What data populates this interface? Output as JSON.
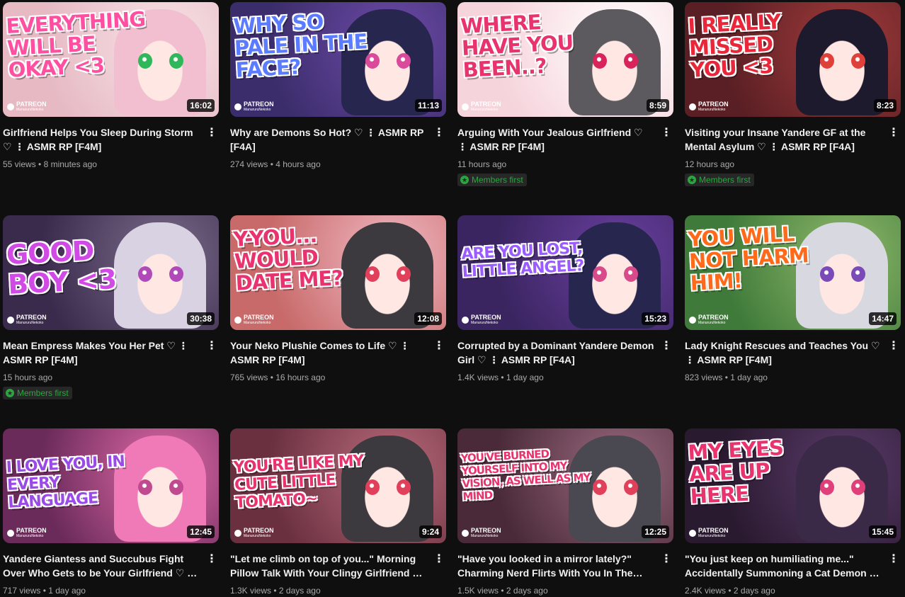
{
  "videos": [
    {
      "title": "Girlfriend Helps You Sleep During Storm ♡ ⋮ ASMR RP [F4M]",
      "views": "55 views",
      "age": "8 minutes ago",
      "duration": "16:02",
      "members_first": "",
      "thumb_text": "Everything will be okay <3",
      "text_color": "#ff4fa0",
      "bg": "#e6b9c3",
      "bg2": "#f7e2e6",
      "hair": "#f2bfd0",
      "eye": "#2fb85a"
    },
    {
      "title": "Why are Demons So Hot? ♡ ⋮ ASMR RP [F4A]",
      "views": "274 views",
      "age": "4 hours ago",
      "duration": "11:13",
      "members_first": "",
      "thumb_text": "Why so pale in the face?",
      "text_color": "#5b7cff",
      "bg": "#3b2d6b",
      "bg2": "#6d4aa8",
      "hair": "#27264f",
      "eye": "#d94a9a"
    },
    {
      "title": "Arguing With Your Jealous Girlfriend ♡ ⋮ ASMR RP [F4M]",
      "views": "",
      "age": "11 hours ago",
      "duration": "8:59",
      "members_first": "Members first",
      "thumb_text": "Where have you been..?",
      "text_color": "#e8336e",
      "bg": "#f6d4dc",
      "bg2": "#ffffff",
      "hair": "#5c5a5e",
      "eye": "#d8245b"
    },
    {
      "title": "Visiting your Insane Yandere GF at the Mental Asylum ♡ ⋮ ASMR RP [F4A]",
      "views": "",
      "age": "12 hours ago",
      "duration": "8:23",
      "members_first": "Members first",
      "thumb_text": "I really missed you <3",
      "text_color": "#e8283a",
      "bg": "#5a1f24",
      "bg2": "#a03a3a",
      "hair": "#1e1a2e",
      "eye": "#e0403a"
    },
    {
      "title": "Mean Empress Makes You Her Pet ♡ ⋮ ASMR RP [F4M]",
      "views": "",
      "age": "15 hours ago",
      "duration": "30:38",
      "members_first": "Members first",
      "thumb_text": "Good boy <3",
      "text_color": "#d14ae6",
      "bg": "#3a2a4c",
      "bg2": "#7a6b8a",
      "hair": "#d9d2e2",
      "eye": "#b04ab8"
    },
    {
      "title": "Your Neko Plushie Comes to Life ♡ ⋮ ASMR RP [F4M]",
      "views": "765 views",
      "age": "16 hours ago",
      "duration": "12:08",
      "members_first": "",
      "thumb_text": "Y-you... would date me?",
      "text_color": "#e8336e",
      "bg": "#c86a6a",
      "bg2": "#f0b8c2",
      "hair": "#3c3a3e",
      "eye": "#e0405a"
    },
    {
      "title": "Corrupted by a Dominant Yandere Demon Girl ♡ ⋮ ASMR RP [F4A]",
      "views": "1.4K views",
      "age": "1 day ago",
      "duration": "15:23",
      "members_first": "",
      "thumb_text": "Are you lost, little angel?",
      "text_color": "#9a5cff",
      "bg": "#3a2560",
      "bg2": "#6a3fa0",
      "hair": "#27264f",
      "eye": "#d94a8a"
    },
    {
      "title": "Lady Knight Rescues and Teaches You ♡ ⋮ ASMR RP [F4M]",
      "views": "823 views",
      "age": "1 day ago",
      "duration": "14:47",
      "members_first": "",
      "thumb_text": "You will not harm him!",
      "text_color": "#ff6a1a",
      "bg": "#3f7a3a",
      "bg2": "#8fb86a",
      "hair": "#d8d8e0",
      "eye": "#7a4ab8"
    },
    {
      "title": "Yandere Giantess and Succubus Fight Over Who Gets to be Your Girlfriend ♡ ⋮ ASMR R…",
      "views": "717 views",
      "age": "1 day ago",
      "duration": "12:45",
      "members_first": "",
      "thumb_text": "I love you, in every language",
      "text_color": "#9a4ae6",
      "bg": "#6a2a5a",
      "bg2": "#e06aa8",
      "hair": "#f07ab8",
      "eye": "#c04a90"
    },
    {
      "title": "\"Let me climb on top of you...\" Morning Pillow Talk With Your Clingy Girlfriend ♡ ⋮…",
      "views": "1.3K views",
      "age": "2 days ago",
      "duration": "9:24",
      "members_first": "",
      "thumb_text": "You're like my cute little tomato~",
      "text_color": "#e8336e",
      "bg": "#6a3040",
      "bg2": "#b86a7a",
      "hair": "#3c3a3e",
      "eye": "#e0405a"
    },
    {
      "title": "\"Have you looked in a mirror lately?\" Charming Nerd Flirts With You In The Libra…",
      "views": "1.5K views",
      "age": "2 days ago",
      "duration": "12:25",
      "members_first": "",
      "thumb_text": "You've burned yourself into my vision, as well as my mind",
      "text_color": "#e8336e",
      "bg": "#4a2a38",
      "bg2": "#9a6a80",
      "hair": "#4a4850",
      "eye": "#e0405a"
    },
    {
      "title": "\"You just keep on humiliating me...\" Accidentally Summoning a Cat Demon ♡ ⋮…",
      "views": "2.4K views",
      "age": "2 days ago",
      "duration": "15:45",
      "members_first": "",
      "thumb_text": "My eyes are up here",
      "text_color": "#e8336e",
      "bg": "#2a1a30",
      "bg2": "#5a3a6a",
      "hair": "#3a2a48",
      "eye": "#e0407a"
    }
  ],
  "patreon_label": "PATREON",
  "patreon_sub": "ManururuNekoko",
  "more_icon": "⋮",
  "star_icon": "★"
}
